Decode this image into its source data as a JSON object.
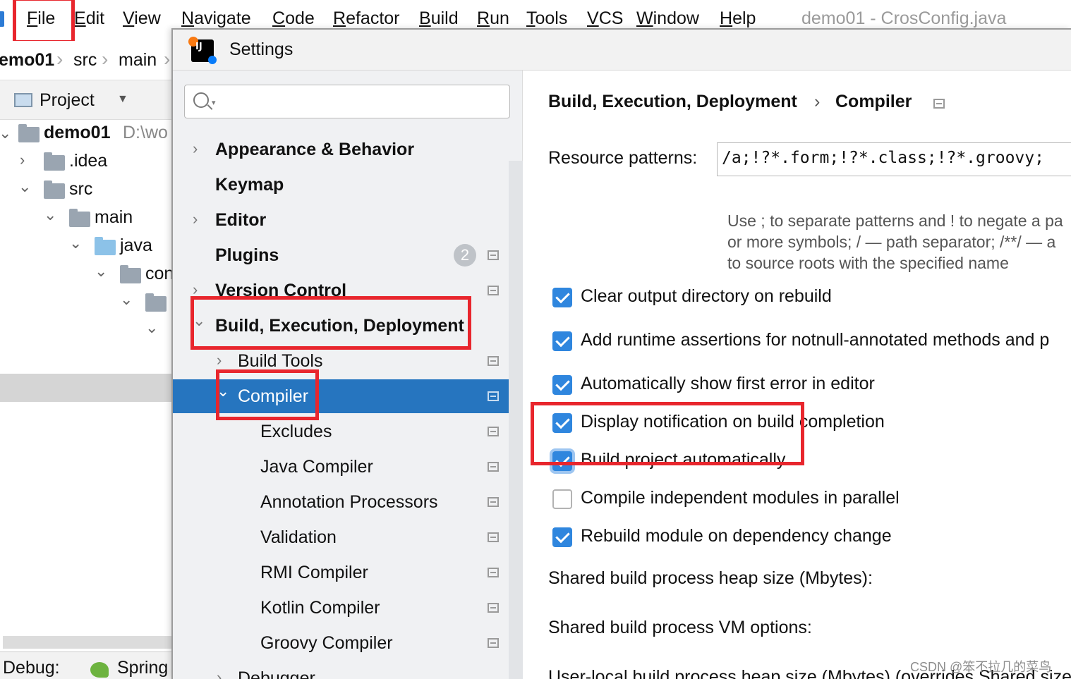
{
  "menubar": {
    "items": [
      {
        "label": "File",
        "mnemonic_index": 0
      },
      {
        "label": "Edit",
        "mnemonic_index": 0
      },
      {
        "label": "View",
        "mnemonic_index": 0
      },
      {
        "label": "Navigate",
        "mnemonic_index": 0
      },
      {
        "label": "Code",
        "mnemonic_index": 0
      },
      {
        "label": "Refactor",
        "mnemonic_index": 0
      },
      {
        "label": "Build",
        "mnemonic_index": 0
      },
      {
        "label": "Run",
        "mnemonic_index": 0
      },
      {
        "label": "Tools",
        "mnemonic_index": 0
      },
      {
        "label": "VCS",
        "mnemonic_index": 0
      },
      {
        "label": "Window",
        "mnemonic_index": 0
      },
      {
        "label": "Help",
        "mnemonic_index": 0
      }
    ],
    "title": "demo01 - CrosConfig.java"
  },
  "breadcrumb": [
    "emo01",
    "src",
    "main"
  ],
  "project_panel": {
    "title": "Project",
    "tree": [
      {
        "label": "demo01",
        "path": "D:\\wo"
      },
      {
        "label": ".idea"
      },
      {
        "label": "src"
      },
      {
        "label": "main"
      },
      {
        "label": "java"
      },
      {
        "label": "con"
      }
    ]
  },
  "statusbar": {
    "debug_label": "Debug:",
    "run_config": "Spring"
  },
  "dialog": {
    "title": "Settings",
    "search": {
      "placeholder": ""
    },
    "nav": [
      {
        "label": "Appearance & Behavior",
        "badge": ""
      },
      {
        "label": "Keymap",
        "badge": ""
      },
      {
        "label": "Editor",
        "badge": ""
      },
      {
        "label": "Plugins",
        "badge": "2"
      },
      {
        "label": "Version Control",
        "badge": ""
      },
      {
        "label": "Build, Execution, Deployment",
        "badge": ""
      },
      {
        "label": "Build Tools",
        "badge": ""
      },
      {
        "label": "Compiler",
        "badge": ""
      },
      {
        "label": "Excludes",
        "badge": ""
      },
      {
        "label": "Java Compiler",
        "badge": ""
      },
      {
        "label": "Annotation Processors",
        "badge": ""
      },
      {
        "label": "Validation",
        "badge": ""
      },
      {
        "label": "RMI Compiler",
        "badge": ""
      },
      {
        "label": "Kotlin Compiler",
        "badge": ""
      },
      {
        "label": "Groovy Compiler",
        "badge": ""
      },
      {
        "label": "Debugger",
        "badge": ""
      }
    ],
    "content": {
      "breadcrumb_parent": "Build, Execution, Deployment",
      "breadcrumb_sep": "›",
      "breadcrumb_current": "Compiler",
      "resource_patterns_label": "Resource patterns:",
      "resource_patterns_value": "/a;!?*.form;!?*.class;!?*.groovy;",
      "hint_lines": [
        "Use ; to separate patterns and ! to negate a pa",
        "or more symbols; / — path separator; /**/ — a",
        "to source roots with the specified name"
      ],
      "checkboxes": [
        {
          "label": "Clear output directory on rebuild",
          "checked": true
        },
        {
          "label": "Add runtime assertions for notnull-annotated methods and p",
          "checked": true
        },
        {
          "label": "Automatically show first error in editor",
          "checked": true
        },
        {
          "label": "Display notification on build completion",
          "checked": true
        },
        {
          "label": "Build project automatically",
          "checked": true
        },
        {
          "label": "Compile independent modules in parallel",
          "checked": false
        },
        {
          "label": "Rebuild module on dependency change",
          "checked": true
        }
      ],
      "shared_heap_label": "Shared build process heap size (Mbytes):",
      "shared_vm_label": "Shared build process VM options:",
      "user_heap_label": "User-local build process heap size (Mbytes) (overrides Shared size"
    }
  },
  "watermark": "CSDN @笨不拉几的菜鸟",
  "colors": {
    "accent": "#2675bf",
    "checkbox": "#2f86de",
    "highlight": "#e8262d"
  }
}
